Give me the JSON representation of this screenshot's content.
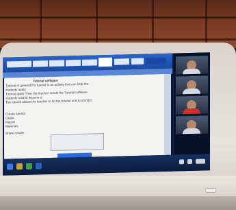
{
  "photo": {
    "subject": "A laptop screen showing a Word-style document and a video call panel",
    "screen": {
      "ribbon_tabs": [
        "",
        "",
        "",
        "",
        "",
        "",
        "",
        "",
        ""
      ],
      "document_lines": [
        "Tutorial software",
        "Tutorial In general the tutorial is an activity that can help the",
        "students apply",
        "Tutorial apply Then the teacher needs the Tutorial software",
        "students tutorial lessons a",
        "The tutorial allows the teacher to do the tutorial and to monitor",
        "",
        "Create tutorial",
        "Grade",
        "Report",
        "Materials",
        "Share results"
      ],
      "apply_button": "",
      "video_tiles": 4
    },
    "colors": {
      "wall": "#7a3a22",
      "bezel": "#e6e2de",
      "ribbon": "#2a63c8",
      "taskbar": "#0c1d3e"
    }
  }
}
